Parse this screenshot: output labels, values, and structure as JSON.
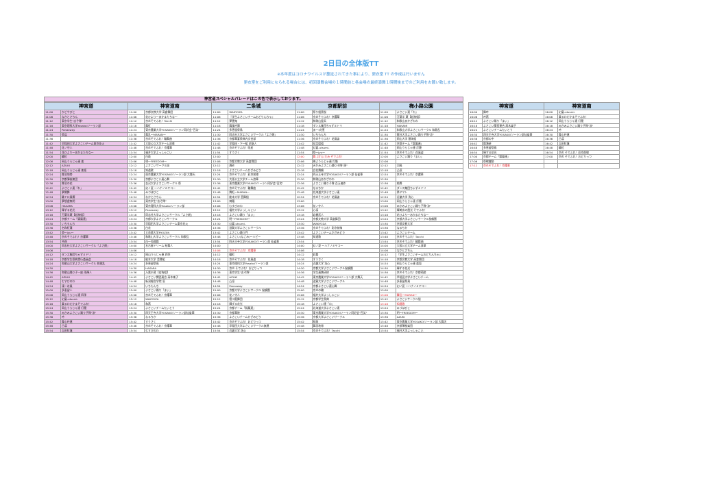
{
  "title": "2日目の全体版TT",
  "notes": [
    "※本年度はコロナウイルスが蔓延されてきた事により、更衣室 TT の作成は行いません",
    "更衣室をご利用になられる場合には、初回演舞会場の１時間前と各会場の最終演舞１時間後までのご利用をお願い致します。"
  ],
  "parade_banner": "神宮道スペシャルパレードはこの色で表示しております。",
  "colors": {
    "header_bg": "#c6dcef",
    "parade_pink": "#ecc7ea",
    "title_blue": "#4aa3e6",
    "highlight_red": "#e0222a"
  },
  "main_headers": [
    "神宮道",
    "神宮道南",
    "二条城",
    "京都駅前",
    "梅小路公園"
  ],
  "right_headers": [
    "神宮道",
    "神宮道南"
  ],
  "main_rows": [
    [
      [
        "11:00",
        "かどやびと",
        1
      ],
      [
        "11:00",
        "京都文教大学 高倉舞団",
        0
      ],
      [
        "11:00",
        "WAKYOZA",
        0
      ],
      [
        "11:00",
        "祭り組黒桜",
        0
      ],
      [
        "11:00",
        "よさこい連「わ」",
        0
      ]
    ],
    [
      [
        "11:06",
        "なかとさちん",
        1
      ],
      [
        "11:06",
        "花ひより～あかまたちな～",
        0
      ],
      [
        "11:06",
        "『学生よさこいチームおどりんちゃ』",
        0
      ],
      [
        "11:06",
        "京炎そでふれ！京躍華",
        0
      ],
      [
        "11:06",
        "万葉半 蔵【若狗組】",
        0
      ]
    ],
    [
      [
        "11:12",
        "東京学生\"志ぞ隊\"",
        1
      ],
      [
        "11:12",
        "京炎そでふれ！Tacchi",
        0
      ],
      [
        "11:12",
        "夢團鬼",
        0
      ],
      [
        "11:12",
        "和歌山屋兵",
        0
      ],
      [
        "11:12",
        "和歌山あかざわわ",
        0
      ]
    ],
    [
      [
        "11:18",
        "東京理科大学Yosakoiソーラン部",
        1
      ],
      [
        "11:18",
        "舞紅",
        0
      ],
      [
        "11:18",
        "舞風吟陣",
        0
      ],
      [
        "11:18",
        "ダンス集団ちゃずミドリ",
        0
      ],
      [
        "11:18",
        "HANAMI",
        0
      ]
    ],
    [
      [
        "11:24",
        "Panasway",
        1
      ],
      [
        "11:24",
        "東京農業大学YOSAKOIソーラン同好会\"百笑\"",
        0
      ],
      [
        "11:24",
        "多恵留祭鳥",
        0
      ],
      [
        "11:24",
        "あー!花恵",
        0
      ],
      [
        "11:24",
        "和歌山大学よさこいサークル 和歌乱",
        0
      ]
    ],
    [
      [
        "11:30",
        "祭盆",
        1
      ],
      [
        "11:30",
        "舞乱～MARAN～",
        0
      ],
      [
        "11:30",
        "同志社大学よさこいサークル「よさ朗」",
        0
      ],
      [
        "11:30",
        "いちもんち",
        0
      ],
      [
        "11:30",
        "龍谷大学よさこい踊り子隊\"涼\"",
        0
      ]
    ],
    [
      [
        "11:36",
        "",
        0
      ],
      [
        "11:36",
        "京炎そでふれ！輪舞曲",
        0
      ],
      [
        "11:36",
        "京都華宴祭典内文芸部",
        0
      ],
      [
        "11:36",
        "京炎そでふれ！花風姿",
        0
      ],
      [
        "11:36",
        "岡山大学 猿海組",
        0
      ]
    ],
    [
      [
        "11:42",
        "早稲田大学よさこいチーム東京花火",
        1
      ],
      [
        "11:42",
        "大阪公立大学チーム浪華",
        0
      ],
      [
        "11:42",
        "早稲田・下一組 花魁人",
        0
      ],
      [
        "11:42",
        "花笑姫組",
        0
      ],
      [
        "11:42",
        "京都チーム「錦鳳連」",
        0
      ]
    ],
    [
      [
        "11:48",
        "花ノ守人",
        1
      ],
      [
        "11:48",
        "京炎そでふれ！京躍華",
        0
      ],
      [
        "11:48",
        "京炎そでふれ！咲産",
        0
      ],
      [
        "11:48",
        "幻宴-utsumi-",
        0
      ],
      [
        "11:48",
        "岡山うらじゃ連 灯籠",
        0
      ]
    ],
    [
      [
        "11:54",
        "花ひより～あかまたちな～",
        1
      ],
      [
        "11:54",
        "福井大学よっしゃこい",
        0
      ],
      [
        "11:54",
        "すうさく",
        0
      ],
      [
        "11:54",
        "祭～jyu～",
        0
      ],
      [
        "11:54",
        "京炎そでふれ！花風姿",
        0
      ]
    ],
    [
      [
        "12:00",
        "輪紅",
        1
      ],
      [
        "12:00",
        "白萩",
        0
      ],
      [
        "12:00",
        "",
        0
      ],
      [
        "12:00",
        "舞 ぶれいだみ ぞでふれ！",
        2
      ],
      [
        "12:00",
        "よさこい踊り「まい」",
        0
      ]
    ],
    [
      [
        "12:06",
        "岡山うらじゃ連 楽",
        1
      ],
      [
        "12:06",
        "明～FREEDOM～",
        0
      ],
      [
        "12:06",
        "京都文教大学 高倉舞団",
        0
      ],
      [
        "12:06",
        "梅ようらじゃ連 灯籠",
        0
      ],
      [
        "12:06",
        "",
        0
      ]
    ],
    [
      [
        "12:12",
        "AZUKI",
        1
      ],
      [
        "12:12",
        "よさこいサークル旭",
        0
      ],
      [
        "12:12",
        "燐砂",
        0
      ],
      [
        "12:12",
        "みかみよさこい踊り子隊\"湛\"",
        0
      ],
      [
        "12:12",
        "羽鳥",
        0
      ]
    ],
    [
      [
        "12:18",
        "岡山うらじゃ連 楽坂",
        1
      ],
      [
        "12:18",
        "知遠歌",
        0
      ],
      [
        "12:18",
        "よさこいチームかざみどり",
        0
      ],
      [
        "12:18",
        "白花舞鶴",
        0
      ],
      [
        "12:18",
        "凸凛",
        0
      ]
    ],
    [
      [
        "12:24",
        "舞羽地帯",
        1
      ],
      [
        "12:24",
        "東京農業大学YOSAKOIソーラン部 大舞天",
        0
      ],
      [
        "12:24",
        "京炎そでふれ！彩京前線",
        0
      ],
      [
        "12:24",
        "四天王寺大学YOSAKOIソーラン部 仙雀華",
        0
      ],
      [
        "12:24",
        "京炎そでふれ！京躍華",
        0
      ]
    ],
    [
      [
        "12:30",
        "京都薄桜楽団",
        1
      ],
      [
        "12:30",
        "京都よさこい連心舞",
        0
      ],
      [
        "12:30",
        "大阪公立大学チーム浪華",
        0
      ],
      [
        "12:30",
        "和歌山あかざわわ",
        0
      ],
      [
        "12:30",
        "",
        0
      ]
    ],
    [
      [
        "12:36",
        "舞羽の花",
        1
      ],
      [
        "12:36",
        "金沢大学よさこいサークル 祭",
        0
      ],
      [
        "12:36",
        "東京農業大学YOSAKOIソーラン同好会\"百笑\"",
        0
      ],
      [
        "12:36",
        "よさこい踊り子隊 百万遍作",
        0
      ],
      [
        "12:36",
        "結舞",
        0
      ]
    ],
    [
      [
        "12:42",
        "よさこい連「わ」",
        1
      ],
      [
        "12:42",
        "幻ノ夏 ～ハナノミヤコ～",
        0
      ],
      [
        "12:42",
        "京炎そでふれ！輪舞曲",
        0
      ],
      [
        "12:42",
        "なるちか",
        0
      ],
      [
        "12:42",
        "ダンス集団ちゃずミドリ",
        0
      ]
    ],
    [
      [
        "12:48",
        "夢響舞",
        1
      ],
      [
        "12:48",
        "みづほびこ",
        0
      ],
      [
        "12:48",
        "舞紅～MARAN～",
        0
      ],
      [
        "12:48",
        "北海道大学よさこい連",
        0
      ],
      [
        "12:48",
        "祭ヤマト",
        0
      ]
    ],
    [
      [
        "12:54",
        "輪ドロ風響",
        1
      ],
      [
        "12:54",
        "なかとさちん",
        0
      ],
      [
        "12:54",
        "能本大学 音舞組",
        0
      ],
      [
        "12:54",
        "京炎そでふれ！花風姿",
        0
      ],
      [
        "12:54",
        "近畿大学 洗心",
        0
      ]
    ],
    [
      [
        "13:00",
        "夢想虚無明",
        1
      ],
      [
        "13:00",
        "東京学生\"志ぞ隊\"",
        0
      ],
      [
        "13:00",
        "綺羅",
        0
      ],
      [
        "13:00",
        "",
        0
      ],
      [
        "13:00",
        "岡山うらじゃ連 灯籠",
        0
      ]
    ],
    [
      [
        "13:06",
        "HASARA",
        1
      ],
      [
        "13:06",
        "東京理科大学Yosakoiソーラン部",
        0
      ],
      [
        "13:06",
        "むすびのわ",
        0
      ],
      [
        "13:06",
        "花ノ守人",
        0
      ],
      [
        "13:06",
        "みかみよさこい踊り子隊\"涼\"",
        0
      ]
    ],
    [
      [
        "13:12",
        "輝ずる花光",
        1
      ],
      [
        "13:12",
        "Panasway",
        0
      ],
      [
        "13:12",
        "福井大学よっしゃこい",
        0
      ],
      [
        "13:12",
        "心凛",
        0
      ],
      [
        "13:12",
        "輝美玄の霞光 そでふれ！",
        0
      ]
    ],
    [
      [
        "13:18",
        "万葉半蔵【若狗組】",
        1
      ],
      [
        "13:18",
        "同志社大学よさこいサークル「よさ朗」",
        0
      ],
      [
        "13:18",
        "よさこい踊り「まい」",
        0
      ],
      [
        "13:18",
        "岩棚武人",
        0
      ],
      [
        "13:18",
        "花ひより～あかまたちな～",
        0
      ]
    ],
    [
      [
        "13:24",
        "京都チーム「錦鳳連」",
        1
      ],
      [
        "13:24",
        "京都大学よさこいサークル",
        0
      ],
      [
        "13:24",
        "明～FREEDOM～",
        0
      ],
      [
        "13:24",
        "京都文教大学 高倉舞団",
        0
      ],
      [
        "13:24",
        "京都大学よさこいサークル桜鶴團",
        0
      ]
    ],
    [
      [
        "13:30",
        "いちもんち",
        1
      ],
      [
        "13:30",
        "早稲田大学よさこいチーム東京花火",
        0
      ],
      [
        "13:30",
        "幻宴-utsumi-",
        0
      ],
      [
        "13:30",
        "WAKYOZA",
        0
      ],
      [
        "13:30",
        "京都文教大学",
        0
      ]
    ],
    [
      [
        "13:36",
        "名和紅蓮",
        1
      ],
      [
        "13:36",
        "白花",
        0
      ],
      [
        "13:36",
        "滋賀大学よさこいサークル",
        0
      ],
      [
        "13:36",
        "京炎そでふれ！彩京前線",
        0
      ],
      [
        "13:36",
        "なるちか",
        0
      ]
    ],
    [
      [
        "13:42",
        "祭～jyu～",
        1
      ],
      [
        "13:42",
        "立命館大学RYOZEN",
        0
      ],
      [
        "13:42",
        "よさこい踊り門",
        0
      ],
      [
        "13:42",
        "よさこいチームかざみどり",
        0
      ],
      [
        "13:42",
        "よさこいチーム",
        0
      ]
    ],
    [
      [
        "13:48",
        "京炎そでふれ！京躍華",
        1
      ],
      [
        "13:48",
        "和歌山大学よさこいサークル 和歌乱",
        0
      ],
      [
        "13:48",
        "よさこい(なごみ)～ハピー",
        0
      ],
      [
        "13:48",
        "知遠歌",
        0
      ],
      [
        "13:48",
        "京炎そでふれ！Tacchi",
        0
      ]
    ],
    [
      [
        "13:54",
        "吟燕",
        1
      ],
      [
        "13:54",
        "白～知遠舞",
        0
      ],
      [
        "13:54",
        "四天王寺大学YOSAKOIソーラン部 仙雀華",
        0
      ],
      [
        "13:54",
        "",
        0
      ],
      [
        "13:54",
        "京炎そでふれ！輪舞曲",
        0
      ]
    ],
    [
      [
        "14:00",
        "同志社大学よさこいサークル「よさ朗」",
        1
      ],
      [
        "14:00",
        "名古屋ドリーム 結舞人",
        0
      ],
      [
        "14:00",
        "",
        0
      ],
      [
        "14:00",
        "幻ノ夏 ～ハナノミヤコ～",
        0
      ],
      [
        "14:00",
        "大阪公立大学チーム浪華",
        0
      ]
    ],
    [
      [
        "14:06",
        "",
        1
      ],
      [
        "14:06",
        "",
        0
      ],
      [
        "14:06",
        "京炎そでふれ！京躍華",
        2
      ],
      [
        "14:06",
        "",
        0
      ],
      [
        "14:06",
        "なかとさちん",
        0
      ]
    ],
    [
      [
        "14:12",
        "ダンス集団ちゃずミドリ",
        1
      ],
      [
        "14:12",
        "岡山うらじゃ連 四季",
        0
      ],
      [
        "14:12",
        "輪紅",
        0
      ],
      [
        "14:12",
        "彩舞",
        0
      ],
      [
        "14:12",
        "『学生よさこいチームおどりんちゃ』",
        0
      ]
    ],
    [
      [
        "14:18",
        "京都学生祭典実行委員会",
        1
      ],
      [
        "14:18",
        "能本大学 音舞組",
        0
      ],
      [
        "14:18",
        "京炎そでふれ！花風姿",
        0
      ],
      [
        "14:18",
        "すうさく",
        0
      ],
      [
        "14:18",
        "京都文教大学 高倉舞団",
        0
      ]
    ],
    [
      [
        "14:24",
        "和歌山大学よさこいサークル 和歌乱",
        1
      ],
      [
        "14:24",
        "多恵留祭鳥",
        0
      ],
      [
        "14:24",
        "東京理科大学Yosakoiソーラン部",
        0
      ],
      [
        "14:24",
        "近畿大学 洗心",
        0
      ],
      [
        "14:24",
        "岡山うらじゃ連 楽坂",
        0
      ]
    ],
    [
      [
        "14:30",
        "",
        1
      ],
      [
        "14:30",
        "HASARA",
        0
      ],
      [
        "14:30",
        "京炎 そでふれ！おどりっつ",
        0
      ],
      [
        "14:30",
        "京都大学よさこいサークル桜鶴團",
        0
      ],
      [
        "14:30",
        "輝ずる花光",
        0
      ]
    ],
    [
      [
        "14:36",
        "和歌山踊り子一座 雨輝人",
        1
      ],
      [
        "14:36",
        "万葉半蔵【若狗組】",
        0
      ],
      [
        "14:36",
        "東京学生\"志ぞ隊\"",
        0
      ],
      [
        "14:36",
        "学生連携研修",
        0
      ],
      [
        "14:36",
        "京炎そでふれ！京都萌酔",
        0
      ]
    ],
    [
      [
        "14:42",
        "AZUKI",
        1
      ],
      [
        "14:42",
        "よさこい関西連合 高木楽子",
        0
      ],
      [
        "14:42",
        "AZUKI",
        0
      ],
      [
        "14:42",
        "東京農業大学YOSAKOIソーラン部 大舞天",
        0
      ],
      [
        "14:42",
        "早稲田大学よさこいチーム",
        0
      ]
    ],
    [
      [
        "14:48",
        "むすびのわ",
        1
      ],
      [
        "14:48",
        "新潟総合学院 凛",
        0
      ],
      [
        "14:48",
        "凸凛",
        0
      ],
      [
        "14:48",
        "滋賀大学よさこいサークル",
        0
      ],
      [
        "14:48",
        "多恵留祭鳥",
        0
      ]
    ],
    [
      [
        "14:54",
        "凍～氷風",
        1
      ],
      [
        "14:54",
        "いちもんち",
        0
      ],
      [
        "14:54",
        "Panasway",
        0
      ],
      [
        "14:54",
        "京都よさこい連心舞",
        0
      ],
      [
        "14:54",
        "幻ノ夏 ～ハナノミヤコ～",
        0
      ]
    ],
    [
      [
        "15:00",
        "多恵留人",
        1
      ],
      [
        "15:00",
        "よさこい踊り「まい」",
        0
      ],
      [
        "15:00",
        "京都大学よさこいサークル 桜鶴團",
        0
      ],
      [
        "15:00",
        "京炎の輪",
        0
      ],
      [
        "15:00",
        "",
        0
      ]
    ],
    [
      [
        "15:06",
        "岡山うらじゃ連 四季",
        1
      ],
      [
        "15:06",
        "京炎そでふれ！京躍華",
        0
      ],
      [
        "15:06",
        "花ノ守人",
        0
      ],
      [
        "15:06",
        "福井大学よっしゃこい",
        0
      ],
      [
        "15:06",
        "舞乱～MARAN～",
        2
      ]
    ],
    [
      [
        "15:12",
        "幻宴-utsumi-",
        1
      ],
      [
        "15:12",
        "WAKYOZA",
        0
      ],
      [
        "15:12",
        "德川龍舞団",
        0
      ],
      [
        "15:12",
        "京都学生祭典",
        0
      ],
      [
        "15:12",
        "よさこいサークル旭",
        0
      ]
    ],
    [
      [
        "15:18",
        "乗るわだかまそでふれ！",
        1
      ],
      [
        "15:18",
        "和燕",
        0
      ],
      [
        "15:18",
        "輝ずる花光",
        0
      ],
      [
        "15:18",
        "よさこい連「わ」",
        0
      ],
      [
        "15:18",
        "知遠歌",
        2
      ]
    ],
    [
      [
        "15:24",
        "岡山うらじゃ連 灯籠",
        1
      ],
      [
        "15:24",
        "よさこいチームたいとう",
        0
      ],
      [
        "15:24",
        "京都チーム「錦鳳連」",
        0
      ],
      [
        "15:24",
        "北海道大学よさこい連",
        0
      ],
      [
        "15:24",
        "みづほびこ",
        0
      ]
    ],
    [
      [
        "15:30",
        "みかみよさこい踊り子隊\"涼\"",
        1
      ],
      [
        "15:30",
        "四天王寺大学YOSAKOIソーラン部仙雀華",
        0
      ],
      [
        "15:30",
        "京都華陵",
        0
      ],
      [
        "15:30",
        "東京農業大学YOSAKOIソーラン同好会\"百笑\"",
        0
      ],
      [
        "15:30",
        "明～FREEDOM～",
        0
      ]
    ],
    [
      [
        "15:36",
        "吟",
        1
      ],
      [
        "15:36",
        "なるちか",
        0
      ],
      [
        "15:36",
        "よさこいチームかざみどり",
        0
      ],
      [
        "15:36",
        "京都大学よさこいサークル",
        0
      ],
      [
        "15:36",
        "AZUKI",
        0
      ]
    ],
    [
      [
        "15:42",
        "舞心吟連",
        1
      ],
      [
        "15:42",
        "すうさく",
        0
      ],
      [
        "15:42",
        "京炎そでふれ！おどりっつ",
        0
      ],
      [
        "15:42",
        "和歌",
        0
      ],
      [
        "15:42",
        "東京農業大学YOSAKOIソーラン部 大舞天",
        0
      ]
    ],
    [
      [
        "15:48",
        "凸凛",
        1
      ],
      [
        "15:48",
        "京炎そでふれ！京躍華",
        0
      ],
      [
        "15:48",
        "早稲田大学よさこいサークル旗連",
        0
      ],
      [
        "15:48",
        "舞羽地帯",
        0
      ],
      [
        "15:48",
        "京都薄桜楽団",
        0
      ]
    ],
    [
      [
        "15:54",
        "吉田紅蓮",
        1
      ],
      [
        "15:54",
        "むすびのわ",
        0
      ],
      [
        "15:54",
        "近畿大学 洗心",
        0
      ],
      [
        "15:54",
        "京炎そでふれ！Tacchi",
        0
      ],
      [
        "15:54",
        "福井大学よっしゃこい",
        0
      ]
    ]
  ],
  "right_rows": [
    [
      [
        "16:00",
        "舞吟"
      ],
      [
        "16:00",
        "幻宴-utsumi-"
      ]
    ],
    [
      [
        "16:06",
        "吟燕"
      ],
      [
        "16:06",
        "乗るわだかまそでふれ！"
      ]
    ],
    [
      [
        "16:12",
        "よさこい踊り「まい」"
      ],
      [
        "16:12",
        "岡山うらじゃ連 灯籠"
      ]
    ],
    [
      [
        "16:18",
        "よさこい関西連合 高木楽子"
      ],
      [
        "16:18",
        "みかみよさこい踊り子隊\"涼\""
      ]
    ],
    [
      [
        "16:24",
        "よさこいチームたいとう"
      ],
      [
        "16:24",
        "吟"
      ]
    ],
    [
      [
        "16:30",
        "四天王寺大学YOSAKOIソーラン部仙雀華"
      ],
      [
        "16:30",
        "舞心吟連"
      ]
    ],
    [
      [
        "16:36",
        "京都の中"
      ],
      [
        "16:36",
        "凸凛"
      ]
    ],
    [
      [
        "16:42",
        "舞湧研"
      ],
      [
        "16:42",
        "吉田紅蓮"
      ]
    ],
    [
      [
        "16:48",
        "多恵留祭鳥"
      ],
      [
        "16:48",
        "輪紅"
      ]
    ],
    [
      [
        "16:54",
        "輝ずる花光"
      ],
      [
        "16:54",
        "京炎 そでふれ！彩京前線"
      ]
    ],
    [
      [
        "17:00",
        "京都チーム「錦鳳連」"
      ],
      [
        "17:00",
        "京炎 そでふれ！おどりっつ"
      ]
    ],
    [
      [
        "17:06",
        "祭戦蹴動"
      ],
      [
        "",
        ""
      ]
    ],
    [
      [
        "17:12",
        "京炎そでふれ！京躍華"
      ],
      [
        "",
        ""
      ]
    ]
  ],
  "right_red_rows": [
    12
  ]
}
